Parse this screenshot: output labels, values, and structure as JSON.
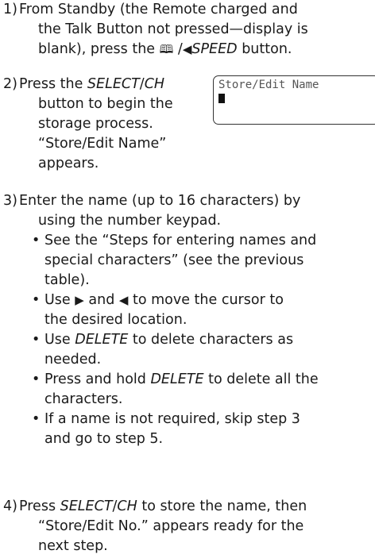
{
  "steps": [
    {
      "num": "1)",
      "lines": [
        "From Standby (the Remote charged and",
        "the Talk Button not pressed—display is"
      ],
      "line3_pre": "blank), press the ",
      "icons": [
        "phone-book-icon",
        "left-arrow-icon"
      ],
      "speed_label": "SPEED",
      "line3_post": " button."
    },
    {
      "num": "2)",
      "press": "Press the ",
      "select_label": "SELECT",
      "slash": "/",
      "ch_label": "CH",
      "lines": [
        "button to begin the",
        "storage process.",
        "“Store/Edit Name”",
        "appears."
      ],
      "lcd_text": "Store/Edit Name"
    },
    {
      "num": "3)",
      "lines": [
        "Enter the name (up to 16 characters) by",
        "using the number keypad."
      ],
      "bullet1": [
        "See the “Steps for entering names and",
        "special characters” (see the previous",
        "table)."
      ],
      "bullet2_pre": "Use ",
      "bullet2_mid": " and ",
      "bullet2_post": " to move the cursor to",
      "bullet2_line2": "the desired location.",
      "bullet3_pre": "Use ",
      "bullet3_delete": "DELETE",
      "bullet3_post": " to delete characters as",
      "bullet3_line2": "needed.",
      "bullet4_pre": "Press and hold ",
      "bullet4_delete": "DELETE",
      "bullet4_post": " to delete all the",
      "bullet4_line2": "characters.",
      "bullet5": [
        "If a name is not required, skip step 3",
        "and go to step 5."
      ]
    },
    {
      "num": "4)",
      "press": "Press ",
      "select_label": "SELECT",
      "slash": "/",
      "ch_label": "CH",
      "post": " to store the name, then",
      "lines": [
        "“Store/Edit No.” appears ready for the",
        "next step."
      ]
    }
  ]
}
